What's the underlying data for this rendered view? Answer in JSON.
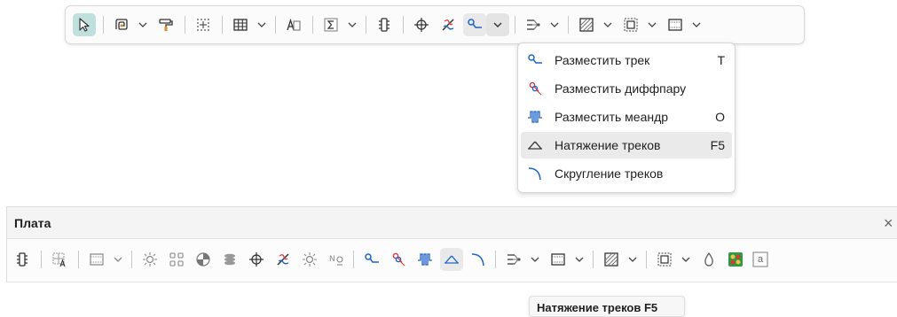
{
  "toolbar": {
    "buttons": [
      {
        "name": "select-tool",
        "icon": "cursor-arrow-icon",
        "active": true
      },
      {
        "name": "graphic-tool",
        "icon": "spiral-shape-icon"
      },
      {
        "name": "format-painter",
        "icon": "paint-roller-icon"
      },
      {
        "name": "snap-grid",
        "icon": "dotted-grid-icon"
      },
      {
        "name": "table",
        "icon": "table-grid-icon"
      },
      {
        "name": "text",
        "icon": "text-box-icon"
      },
      {
        "name": "dimension",
        "icon": "sigma-box-icon"
      },
      {
        "name": "component",
        "icon": "component-pins-icon"
      },
      {
        "name": "via",
        "icon": "crosshair-via-icon"
      },
      {
        "name": "pcb-tools",
        "icon": "magic-tool-icon"
      },
      {
        "name": "route-track",
        "icon": "route-track-icon",
        "pressed": true
      },
      {
        "name": "net-tools",
        "icon": "net-branches-icon"
      },
      {
        "name": "polygon",
        "icon": "hatched-square-icon"
      },
      {
        "name": "keepout",
        "icon": "dotted-square-icon"
      },
      {
        "name": "board",
        "icon": "board-outline-icon"
      }
    ]
  },
  "menu": {
    "items": [
      {
        "label": "Разместить трек",
        "shortcut": "T",
        "icon": "route-track-icon"
      },
      {
        "label": "Разместить диффпару",
        "shortcut": "",
        "icon": "diff-pair-icon"
      },
      {
        "label": "Разместить меандр",
        "shortcut": "O",
        "icon": "meander-icon"
      },
      {
        "label": "Натяжение треков",
        "shortcut": "F5",
        "icon": "track-tension-icon",
        "hover": true
      },
      {
        "label": "Скругление треков",
        "shortcut": "",
        "icon": "track-rounding-icon"
      }
    ]
  },
  "panel": {
    "title": "Плата",
    "close": "×",
    "ref_label": "a"
  },
  "tooltip": {
    "text": "Натяжение треков F5"
  },
  "colors": {
    "accent_active": "#bfe0dc",
    "icon_blue": "#1d63c7",
    "icon_red": "#d63a3a",
    "icon_green": "#2f9a3f"
  }
}
